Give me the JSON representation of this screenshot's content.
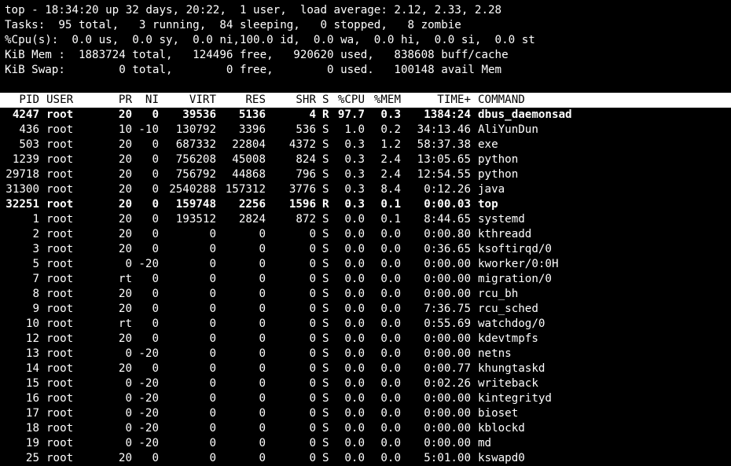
{
  "summary": [
    "top - 18:34:20 up 32 days, 20:22,  1 user,  load average: 2.12, 2.33, 2.28",
    "Tasks:  95 total,   3 running,  84 sleeping,   0 stopped,   8 zombie",
    "%Cpu(s):  0.0 us,  0.0 sy,  0.0 ni,100.0 id,  0.0 wa,  0.0 hi,  0.0 si,  0.0 st",
    "KiB Mem :  1883724 total,   124496 free,   920620 used,   838608 buff/cache",
    "KiB Swap:        0 total,        0 free,        0 used.   100148 avail Mem"
  ],
  "columns": [
    "PID",
    "USER",
    "PR",
    "NI",
    "VIRT",
    "RES",
    "SHR",
    "S",
    "%CPU",
    "%MEM",
    "TIME+",
    "COMMAND"
  ],
  "processes": [
    {
      "pid": "4247",
      "user": "root",
      "pr": "20",
      "ni": "0",
      "virt": "39536",
      "res": "5136",
      "shr": "4",
      "s": "R",
      "cpu": "97.7",
      "mem": "0.3",
      "time": "1384:24",
      "cmd": "dbus_daemonsad",
      "bold": true
    },
    {
      "pid": "436",
      "user": "root",
      "pr": "10",
      "ni": "-10",
      "virt": "130792",
      "res": "3396",
      "shr": "536",
      "s": "S",
      "cpu": "1.0",
      "mem": "0.2",
      "time": "34:13.46",
      "cmd": "AliYunDun",
      "bold": false
    },
    {
      "pid": "503",
      "user": "root",
      "pr": "20",
      "ni": "0",
      "virt": "687332",
      "res": "22804",
      "shr": "4372",
      "s": "S",
      "cpu": "0.3",
      "mem": "1.2",
      "time": "58:37.38",
      "cmd": "exe",
      "bold": false
    },
    {
      "pid": "1239",
      "user": "root",
      "pr": "20",
      "ni": "0",
      "virt": "756208",
      "res": "45008",
      "shr": "824",
      "s": "S",
      "cpu": "0.3",
      "mem": "2.4",
      "time": "13:05.65",
      "cmd": "python",
      "bold": false
    },
    {
      "pid": "29718",
      "user": "root",
      "pr": "20",
      "ni": "0",
      "virt": "756792",
      "res": "44868",
      "shr": "796",
      "s": "S",
      "cpu": "0.3",
      "mem": "2.4",
      "time": "12:54.55",
      "cmd": "python",
      "bold": false
    },
    {
      "pid": "31300",
      "user": "root",
      "pr": "20",
      "ni": "0",
      "virt": "2540288",
      "res": "157312",
      "shr": "3776",
      "s": "S",
      "cpu": "0.3",
      "mem": "8.4",
      "time": "0:12.26",
      "cmd": "java",
      "bold": false
    },
    {
      "pid": "32251",
      "user": "root",
      "pr": "20",
      "ni": "0",
      "virt": "159748",
      "res": "2256",
      "shr": "1596",
      "s": "R",
      "cpu": "0.3",
      "mem": "0.1",
      "time": "0:00.03",
      "cmd": "top",
      "bold": true
    },
    {
      "pid": "1",
      "user": "root",
      "pr": "20",
      "ni": "0",
      "virt": "193512",
      "res": "2824",
      "shr": "872",
      "s": "S",
      "cpu": "0.0",
      "mem": "0.1",
      "time": "8:44.65",
      "cmd": "systemd",
      "bold": false
    },
    {
      "pid": "2",
      "user": "root",
      "pr": "20",
      "ni": "0",
      "virt": "0",
      "res": "0",
      "shr": "0",
      "s": "S",
      "cpu": "0.0",
      "mem": "0.0",
      "time": "0:00.80",
      "cmd": "kthreadd",
      "bold": false
    },
    {
      "pid": "3",
      "user": "root",
      "pr": "20",
      "ni": "0",
      "virt": "0",
      "res": "0",
      "shr": "0",
      "s": "S",
      "cpu": "0.0",
      "mem": "0.0",
      "time": "0:36.65",
      "cmd": "ksoftirqd/0",
      "bold": false
    },
    {
      "pid": "5",
      "user": "root",
      "pr": "0",
      "ni": "-20",
      "virt": "0",
      "res": "0",
      "shr": "0",
      "s": "S",
      "cpu": "0.0",
      "mem": "0.0",
      "time": "0:00.00",
      "cmd": "kworker/0:0H",
      "bold": false
    },
    {
      "pid": "7",
      "user": "root",
      "pr": "rt",
      "ni": "0",
      "virt": "0",
      "res": "0",
      "shr": "0",
      "s": "S",
      "cpu": "0.0",
      "mem": "0.0",
      "time": "0:00.00",
      "cmd": "migration/0",
      "bold": false
    },
    {
      "pid": "8",
      "user": "root",
      "pr": "20",
      "ni": "0",
      "virt": "0",
      "res": "0",
      "shr": "0",
      "s": "S",
      "cpu": "0.0",
      "mem": "0.0",
      "time": "0:00.00",
      "cmd": "rcu_bh",
      "bold": false
    },
    {
      "pid": "9",
      "user": "root",
      "pr": "20",
      "ni": "0",
      "virt": "0",
      "res": "0",
      "shr": "0",
      "s": "S",
      "cpu": "0.0",
      "mem": "0.0",
      "time": "7:36.75",
      "cmd": "rcu_sched",
      "bold": false
    },
    {
      "pid": "10",
      "user": "root",
      "pr": "rt",
      "ni": "0",
      "virt": "0",
      "res": "0",
      "shr": "0",
      "s": "S",
      "cpu": "0.0",
      "mem": "0.0",
      "time": "0:55.69",
      "cmd": "watchdog/0",
      "bold": false
    },
    {
      "pid": "12",
      "user": "root",
      "pr": "20",
      "ni": "0",
      "virt": "0",
      "res": "0",
      "shr": "0",
      "s": "S",
      "cpu": "0.0",
      "mem": "0.0",
      "time": "0:00.00",
      "cmd": "kdevtmpfs",
      "bold": false
    },
    {
      "pid": "13",
      "user": "root",
      "pr": "0",
      "ni": "-20",
      "virt": "0",
      "res": "0",
      "shr": "0",
      "s": "S",
      "cpu": "0.0",
      "mem": "0.0",
      "time": "0:00.00",
      "cmd": "netns",
      "bold": false
    },
    {
      "pid": "14",
      "user": "root",
      "pr": "20",
      "ni": "0",
      "virt": "0",
      "res": "0",
      "shr": "0",
      "s": "S",
      "cpu": "0.0",
      "mem": "0.0",
      "time": "0:00.77",
      "cmd": "khungtaskd",
      "bold": false
    },
    {
      "pid": "15",
      "user": "root",
      "pr": "0",
      "ni": "-20",
      "virt": "0",
      "res": "0",
      "shr": "0",
      "s": "S",
      "cpu": "0.0",
      "mem": "0.0",
      "time": "0:02.26",
      "cmd": "writeback",
      "bold": false
    },
    {
      "pid": "16",
      "user": "root",
      "pr": "0",
      "ni": "-20",
      "virt": "0",
      "res": "0",
      "shr": "0",
      "s": "S",
      "cpu": "0.0",
      "mem": "0.0",
      "time": "0:00.00",
      "cmd": "kintegrityd",
      "bold": false
    },
    {
      "pid": "17",
      "user": "root",
      "pr": "0",
      "ni": "-20",
      "virt": "0",
      "res": "0",
      "shr": "0",
      "s": "S",
      "cpu": "0.0",
      "mem": "0.0",
      "time": "0:00.00",
      "cmd": "bioset",
      "bold": false
    },
    {
      "pid": "18",
      "user": "root",
      "pr": "0",
      "ni": "-20",
      "virt": "0",
      "res": "0",
      "shr": "0",
      "s": "S",
      "cpu": "0.0",
      "mem": "0.0",
      "time": "0:00.00",
      "cmd": "kblockd",
      "bold": false
    },
    {
      "pid": "19",
      "user": "root",
      "pr": "0",
      "ni": "-20",
      "virt": "0",
      "res": "0",
      "shr": "0",
      "s": "S",
      "cpu": "0.0",
      "mem": "0.0",
      "time": "0:00.00",
      "cmd": "md",
      "bold": false
    },
    {
      "pid": "25",
      "user": "root",
      "pr": "20",
      "ni": "0",
      "virt": "0",
      "res": "0",
      "shr": "0",
      "s": "S",
      "cpu": "0.0",
      "mem": "0.0",
      "time": "5:01.00",
      "cmd": "kswapd0",
      "bold": false
    }
  ]
}
